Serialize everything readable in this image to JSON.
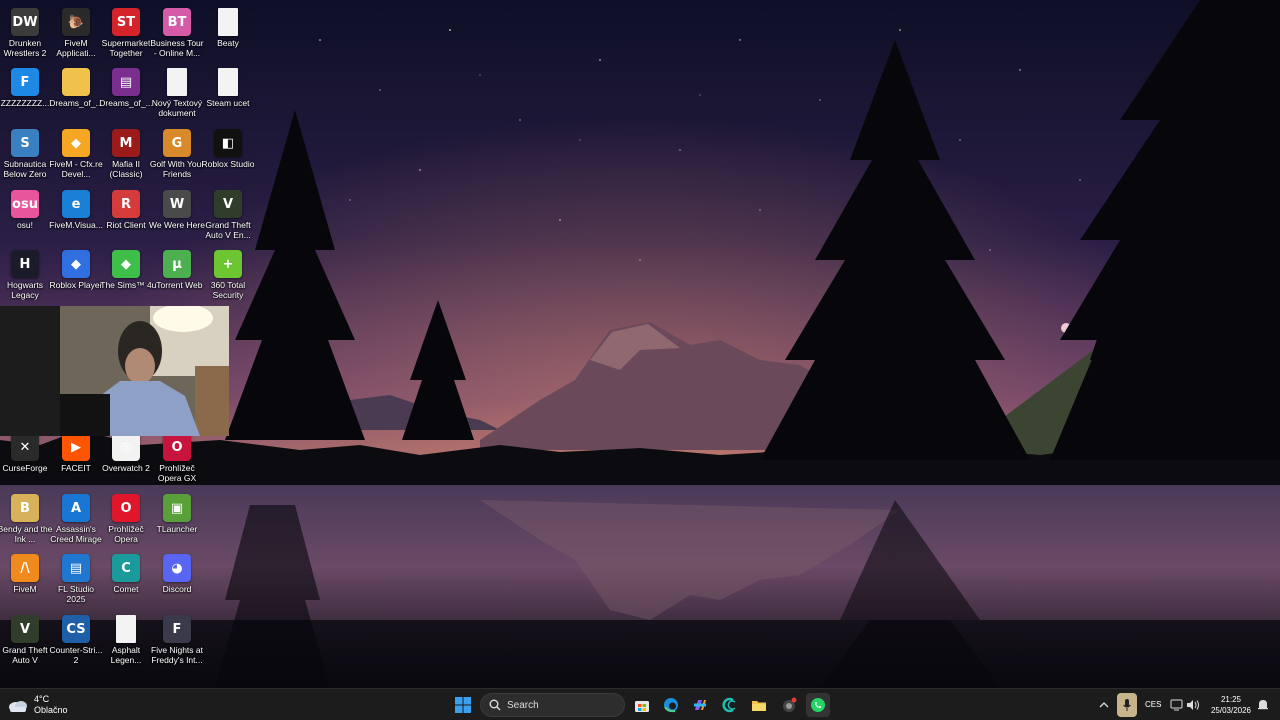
{
  "desktop": {
    "icons": [
      {
        "label": "Drunken Wrestlers 2",
        "glyph": "DW",
        "color": "#3b3b3b"
      },
      {
        "label": "FiveM Applicati...",
        "glyph": "🐌",
        "color": "#2a2a2a"
      },
      {
        "label": "Supermarket Together",
        "glyph": "ST",
        "color": "#d4232b"
      },
      {
        "label": "Business Tour - Online M...",
        "glyph": "BT",
        "color": "#d55aa8"
      },
      {
        "label": "Beaty",
        "glyph": "",
        "color": "#f3f3f3"
      },
      {
        "label": "ZZZZZZZZ...",
        "glyph": "F",
        "color": "#1e88e5"
      },
      {
        "label": "Dreams_of_...",
        "glyph": "",
        "color": "#f0c14b"
      },
      {
        "label": "Dreams_of_...",
        "glyph": "▤",
        "color": "#7a2e8e"
      },
      {
        "label": "Nový Textový dokument",
        "glyph": "",
        "color": "#f3f3f3"
      },
      {
        "label": "Steam ucet",
        "glyph": "",
        "color": "#f3f3f3"
      },
      {
        "label": "Subnautica Below Zero",
        "glyph": "S",
        "color": "#3a7fbf"
      },
      {
        "label": "FiveM - Cfx.re Devel...",
        "glyph": "◆",
        "color": "#f5a623"
      },
      {
        "label": "Mafia II (Classic)",
        "glyph": "M",
        "color": "#9b1b1b"
      },
      {
        "label": "Golf With Your Friends",
        "glyph": "G",
        "color": "#d88a2a"
      },
      {
        "label": "Roblox Studio",
        "glyph": "◧",
        "color": "#111111"
      },
      {
        "label": "osu!",
        "glyph": "osu",
        "color": "#e9559c"
      },
      {
        "label": "FiveM.Visua...",
        "glyph": "e",
        "color": "#1a7fd6"
      },
      {
        "label": "Riot Client",
        "glyph": "R",
        "color": "#d63b3b"
      },
      {
        "label": "We Were Here",
        "glyph": "W",
        "color": "#4a4a4a"
      },
      {
        "label": "Grand Theft Auto V En...",
        "glyph": "V",
        "color": "#2f3d2a"
      },
      {
        "label": "Hogwarts Legacy",
        "glyph": "H",
        "color": "#1b1b2a"
      },
      {
        "label": "Roblox Player",
        "glyph": "◆",
        "color": "#2f6fe0"
      },
      {
        "label": "The Sims™ 4",
        "glyph": "◆",
        "color": "#3fbf4a"
      },
      {
        "label": "uTorrent Web",
        "glyph": "μ",
        "color": "#4caf50"
      },
      {
        "label": "360 Total Security",
        "glyph": "+",
        "color": "#6cc531"
      },
      {
        "label": "CurseForge",
        "glyph": "✕",
        "color": "#2a2a2a"
      },
      {
        "label": "FACEIT",
        "glyph": "▶",
        "color": "#ff5500"
      },
      {
        "label": "Overwatch 2",
        "glyph": "◎",
        "color": "#f2f2f2"
      },
      {
        "label": "Prohlížeč Opera GX",
        "glyph": "O",
        "color": "#c8143c"
      },
      {
        "label": "Bendy and the Ink ...",
        "glyph": "B",
        "color": "#d8b25a"
      },
      {
        "label": "Assassin's Creed Mirage",
        "glyph": "A",
        "color": "#1976d2"
      },
      {
        "label": "Prohlížeč Opera",
        "glyph": "O",
        "color": "#e0162b"
      },
      {
        "label": "TLauncher",
        "glyph": "▣",
        "color": "#5aa03a"
      },
      {
        "label": "FiveM",
        "glyph": "/\\",
        "color": "#f08a1c"
      },
      {
        "label": "FL Studio 2025",
        "glyph": "▤",
        "color": "#1f77d0"
      },
      {
        "label": "Comet",
        "glyph": "C",
        "color": "#1a9a9a"
      },
      {
        "label": "Discord",
        "glyph": "◕",
        "color": "#5865f2"
      },
      {
        "label": "Grand Theft Auto V",
        "glyph": "V",
        "color": "#2f3d2a"
      },
      {
        "label": "Counter-Stri... 2",
        "glyph": "CS",
        "color": "#1f5fa8"
      },
      {
        "label": "Asphalt Legen...",
        "glyph": "",
        "color": "#f3f3f3"
      },
      {
        "label": "Five Nights at Freddy's Int...",
        "glyph": "F",
        "color": "#3a3a4a"
      }
    ]
  },
  "taskbar": {
    "weather": {
      "temp": "4°C",
      "condition": "Oblačno"
    },
    "search": {
      "label": "Search"
    },
    "pinned": [
      "windows-start",
      "search",
      "store",
      "edge",
      "copilot",
      "comet",
      "file-explorer",
      "discord-like",
      "whatsapp"
    ],
    "tray": {
      "language": "CES",
      "time": "21:25",
      "date": "25/03/2026"
    }
  }
}
